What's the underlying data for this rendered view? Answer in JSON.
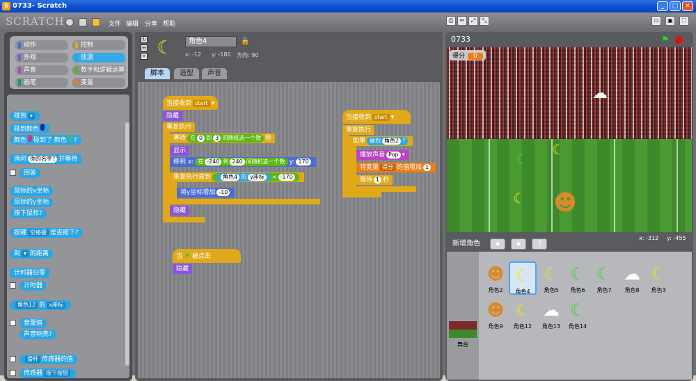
{
  "window": {
    "title": "0733- Scratch"
  },
  "menu": {
    "logo": "SCRATCH",
    "items": [
      "文件",
      "编辑",
      "分享",
      "帮助"
    ]
  },
  "categories": [
    {
      "label": "动作",
      "color": "#4a6cd4"
    },
    {
      "label": "控制",
      "color": "#e1a91a"
    },
    {
      "label": "外观",
      "color": "#8a55d7"
    },
    {
      "label": "侦测",
      "color": "#2ca5e2"
    },
    {
      "label": "声音",
      "color": "#bb42c3"
    },
    {
      "label": "数字和逻辑运算",
      "color": "#5cb712"
    },
    {
      "label": "画笔",
      "color": "#0e9a6c"
    },
    {
      "label": "变量",
      "color": "#ee7d16"
    }
  ],
  "palette_blocks": {
    "touching": "碰到",
    "touching_color": "碰到颜色",
    "color": "颜色",
    "color_touch": "碰到了 颜色",
    "color_q": "?",
    "ask": "询问",
    "ask_default": "你的名字?",
    "and_wait": "并等待",
    "answer": "回答",
    "mousex": "鼠标的x坐标",
    "mousey": "鼠标的y坐标",
    "mousedown": "按下鼠标?",
    "key_prefix": "按键",
    "key_name": "空格键",
    "key_suffix": "是否按下?",
    "distance_prefix": "到",
    "distance_suffix": "的距离",
    "reset_timer": "计时器归零",
    "timer": "计时器",
    "of_sprite": "角色12",
    "of_word": "的",
    "of_attr": "x座标",
    "loudness": "音量值",
    "loud": "声音响亮?",
    "slider": "滑杆",
    "sensor_value": "传感器的值",
    "sensor_prefix": "传感器",
    "sensor_key": "按下按钮"
  },
  "sprite": {
    "name": "角色4",
    "x_label": "x: -12",
    "y_label": "y: -180",
    "dir_label": "方向: 90"
  },
  "tabs": [
    "脚本",
    "造型",
    "声音"
  ],
  "script1": {
    "when_receive": "当接收到",
    "msg": "start",
    "hide": "隐藏",
    "forever": "重复执行",
    "wait": "等待",
    "rand_a": "在",
    "rand_from": "0",
    "rand_to_word": "到",
    "rand_to": "3",
    "rand_word": "间随机选一个数",
    "sec": "秒",
    "show": "显示",
    "goto_x": "移到 x:",
    "rx_a": "在",
    "rx_from": "-240",
    "rx_to_word": "到",
    "rx_to": "240",
    "rx_word": "间随机选一个数",
    "y_word": "y:",
    "y_val": "170",
    "repeat_until": "重复执行直到",
    "of_sprite": "角色4",
    "of_word": "的",
    "of_attr": "y座标",
    "lt": "<",
    "lt_val": "-170",
    "change_y": "将y坐标增加",
    "change_y_val": "-10",
    "hide2": "隐藏"
  },
  "script2": {
    "when": "当",
    "clicked": "被点击",
    "hide": "隐藏"
  },
  "script3": {
    "when_receive": "当接收到",
    "msg": "start",
    "forever": "重复执行",
    "if": "如果",
    "touching": "碰到",
    "touch_target": "角色2",
    "q": "?",
    "play": "播放声音",
    "sound": "Pop",
    "change_var": "将变量",
    "var": "得分",
    "change_by": "的值增加",
    "change_val": "1",
    "wait": "等待",
    "wait_val": "1",
    "sec": "秒"
  },
  "stage": {
    "title": "0733",
    "score_label": "得分",
    "score_value": "0",
    "mouse_x": "x: -312",
    "mouse_y": "y: -455"
  },
  "sprites_panel": {
    "new_label": "新增角色",
    "stage_label": "舞台",
    "items": [
      {
        "name": "角色2",
        "icon": "monkey"
      },
      {
        "name": "角色4",
        "icon": "banana"
      },
      {
        "name": "角色5",
        "icon": "banana"
      },
      {
        "name": "角色6",
        "icon": "banana-green"
      },
      {
        "name": "角色7",
        "icon": "banana-green"
      },
      {
        "name": "角色8",
        "icon": "ghost"
      },
      {
        "name": "角色3",
        "icon": "banana"
      },
      {
        "name": "角色9",
        "icon": "monkey"
      },
      {
        "name": "角色12",
        "icon": "banana"
      },
      {
        "name": "角色13",
        "icon": "ghost"
      },
      {
        "name": "角色14",
        "icon": "banana-green"
      }
    ]
  }
}
